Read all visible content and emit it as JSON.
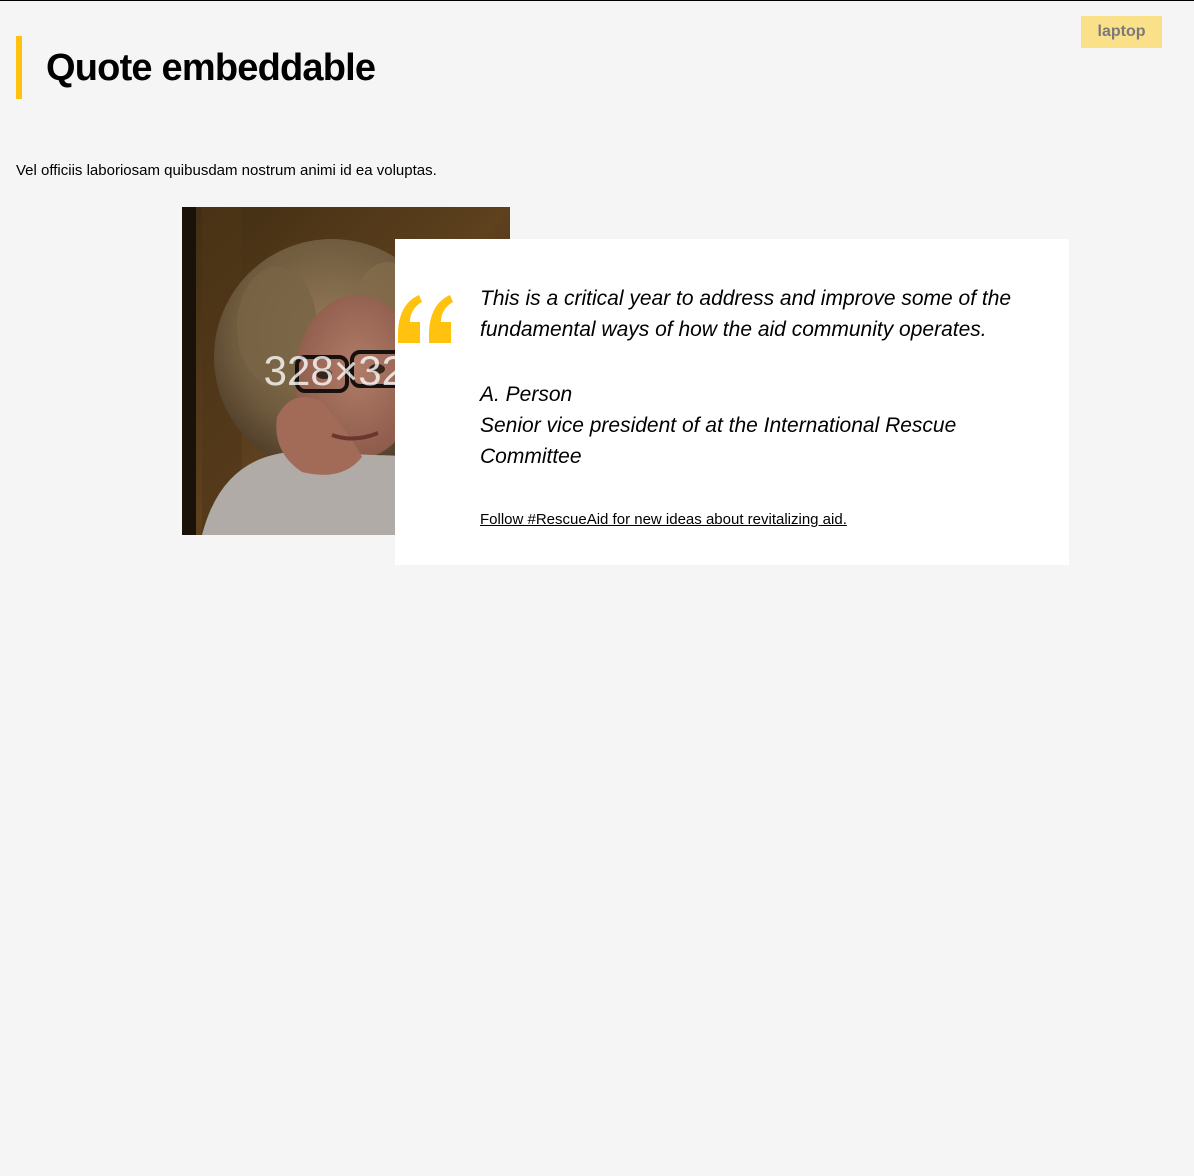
{
  "badge": {
    "label": "laptop"
  },
  "header": {
    "title": "Quote embeddable"
  },
  "intro": {
    "text": "Vel officiis laboriosam quibusdam nostrum animi id ea voluptas."
  },
  "image": {
    "placeholder_label": "328×328",
    "alt": "Portrait of a woman with glasses resting her chin on her hand"
  },
  "quote": {
    "text": "This is a critical year to address and improve some of the fundamental ways of how the aid community operates.",
    "author_name": "A. Person",
    "author_title": "Senior vice president of at the International Rescue Committee",
    "link_text": "Follow #RescueAid for new ideas about revitalizing aid."
  },
  "colors": {
    "accent": "#ffc20e",
    "badge_bg": "#fbe08a",
    "page_bg": "#f5f5f5",
    "card_bg": "#ffffff"
  },
  "icons": {
    "quote_mark": "quote-mark-icon"
  }
}
